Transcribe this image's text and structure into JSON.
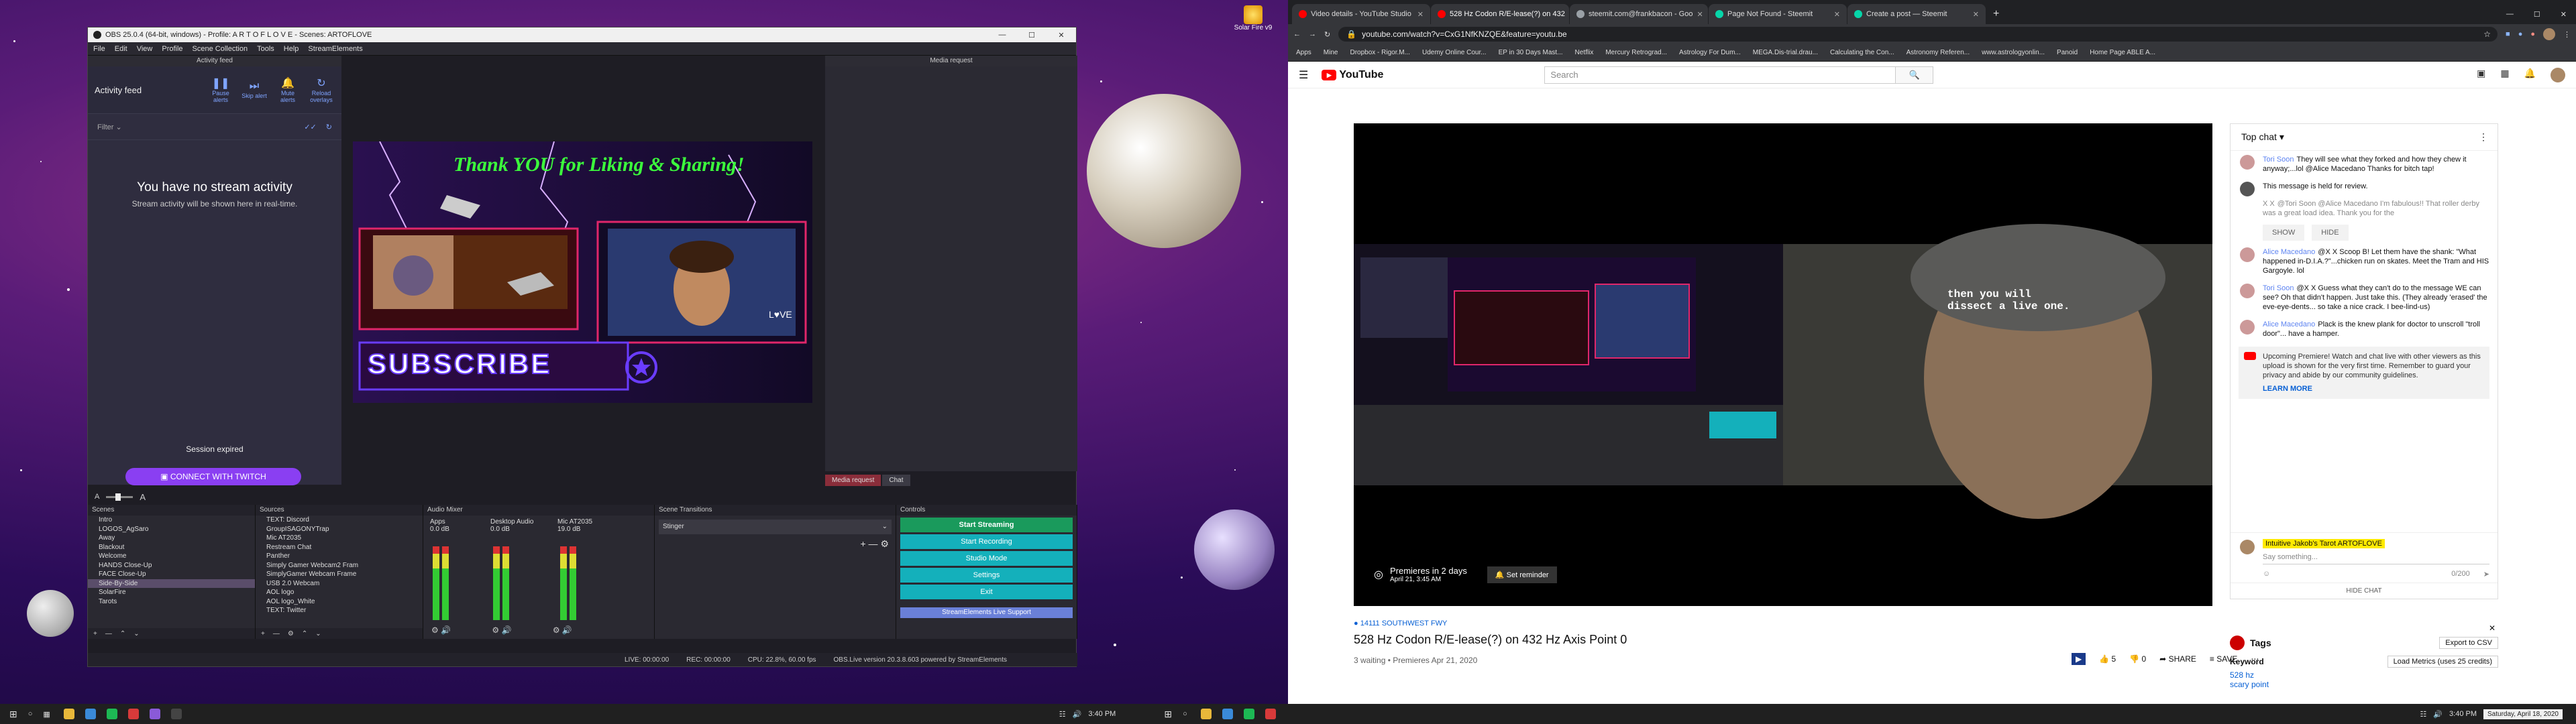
{
  "desktop": {
    "icon_label": "Solar Fire v9"
  },
  "obs": {
    "title": "OBS 25.0.4 (64-bit, windows) - Profile: A R T O F L O V E - Scenes: ARTOFLOVE",
    "menu": [
      "File",
      "Edit",
      "View",
      "Profile",
      "Scene Collection",
      "Tools",
      "Help",
      "StreamElements"
    ],
    "activity": {
      "dock_title": "Activity feed",
      "header": "Activity feed",
      "actions": [
        {
          "icon": "pause-icon",
          "label": "Pause alerts"
        },
        {
          "icon": "skip-icon",
          "label": "Skip alert"
        },
        {
          "icon": "mute-icon",
          "label": "Mute alerts"
        },
        {
          "icon": "reload-icon",
          "label": "Reload overlays"
        }
      ],
      "filter": "Filter",
      "empty_title": "You have no stream activity",
      "empty_text": "Stream activity will be shown here in real-time.",
      "session": "Session expired",
      "connect": "CONNECT WITH TWITCH"
    },
    "preview": {
      "banner": "Thank YOU for Liking & Sharing!",
      "subscribe": "SUBSCRIBE",
      "love": "L♥VE"
    },
    "media": {
      "dock_title": "Media request",
      "tabs": [
        "Media request",
        "Chat"
      ]
    },
    "scenes": {
      "title": "Scenes",
      "items": [
        "Intro",
        "LOGOS_AgSaro",
        "Away",
        "Blackout",
        "Welcome",
        "HANDS Close-Up",
        "FACE Close-Up",
        "Side-By-Side",
        "SolarFire",
        "Tarots"
      ],
      "selected": "Side-By-Side"
    },
    "sources": {
      "title": "Sources",
      "items": [
        "TEXT: Discord",
        "GroupISAGONYTrap",
        "Mic AT2035",
        "Restream Chat",
        "Panther",
        "Simply Gamer Webcam2 Fram",
        "SimplyGamer Webcam Frame",
        "USB 2.0 Webcam",
        "AOL logo",
        "AOL logo_White",
        "TEXT: Twitter"
      ]
    },
    "mixer": {
      "title": "Audio Mixer",
      "channels": [
        {
          "name": "Apps",
          "db": "0.0 dB"
        },
        {
          "name": "Desktop Audio",
          "db": "0.0 dB"
        },
        {
          "name": "Mic AT2035",
          "db": "19.0 dB"
        }
      ]
    },
    "transitions": {
      "title": "Scene Transitions",
      "selected": "Stinger"
    },
    "controls": {
      "title": "Controls",
      "buttons": [
        "Start Streaming",
        "Start Recording",
        "Studio Mode",
        "Settings",
        "Exit"
      ],
      "support": "StreamElements Live Support"
    },
    "status": {
      "live": "LIVE: 00:00:00",
      "rec": "REC: 00:00:00",
      "cpu": "CPU: 22.8%, 60.00 fps",
      "version": "OBS.Live version 20.3.8.603 powered by StreamElements"
    }
  },
  "chrome": {
    "tabs": [
      {
        "title": "Video details - YouTube Studio",
        "color": "#ff0000"
      },
      {
        "title": "528 Hz Codon R/E-lease(?) on 432",
        "color": "#ff0000"
      },
      {
        "title": "steemit.com@frankbacon - Goo",
        "color": "#9aa0a6"
      },
      {
        "title": "Page Not Found - Steemit",
        "color": "#06d6a9"
      },
      {
        "title": "Create a post — Steemit",
        "color": "#06d6a9"
      }
    ],
    "url": "youtube.com/watch?v=CxG1NfKNZQE&feature=youtu.be",
    "bookmarks": [
      "Apps",
      "Mine",
      "Dropbox - Rigor.M...",
      "Udemy Online Cour...",
      "EP in 30 Days Mast...",
      "Netflix",
      "Mercury Retrograd...",
      "Astrology For Dum...",
      "MEGA.Dis-trial.drau...",
      "Calculating the Con...",
      "Astronomy Referen...",
      "www.astrologyonlin...",
      "Panoid",
      "Home Page ABLE A..."
    ],
    "youtube": {
      "logo": "YouTube",
      "search_placeholder": "Search",
      "player": {
        "overlay_text": "then you will\ndissect a live one.",
        "premiere_line1": "Premieres in 2 days",
        "premiere_line2": "April 21, 3:45 AM",
        "reminder": "Set reminder"
      },
      "location": "14111 SOUTHWEST FWY",
      "video_title": "528 Hz Codon R/E-lease(?) on 432 Hz Axis Point 0",
      "meta": "3 waiting • Premieres Apr 21, 2020",
      "actions": {
        "likes": "5",
        "dislikes": "0",
        "share": "SHARE",
        "save": "SAVE"
      },
      "chat": {
        "header": "Top chat",
        "messages": [
          {
            "author": "Tori Soon",
            "text": "They will see what they forked and how they chew it anyway;...lol @Alice Macedano Thanks for bitch tap!"
          },
          {
            "author": "",
            "text": "This message is held for review."
          },
          {
            "author": "X X",
            "text": "@Tori Soon @Alice Macedano I'm fabulous!! That roller derby was a great load idea. Thank you for the"
          },
          {
            "author": "Alice Macedano",
            "text": "@X X Scoop B! Let them have the shank: \"What happened in-D.I.A.?\"...chicken run on skates. Meet the Tram and HIS Gargoyle. lol"
          },
          {
            "author": "Tori Soon",
            "text": "@X X Guess what they can't do to the message WE can see? Oh that didn't happen. Just take this. (They already 'erased' the eve-eye-dents... so take a nice crack. I bee-lind-us)"
          },
          {
            "author": "Alice Macedano",
            "text": "Plack is the knew plank for doctor to unscroll \"troll door\"... have a hamper."
          }
        ],
        "show": "SHOW",
        "hide": "HIDE",
        "premiere_notice": "Upcoming Premiere! Watch and chat live with other viewers as this upload is shown for the very first time. Remember to guard your privacy and abide by our community guidelines.",
        "learn_more": "LEARN MORE",
        "user_label": "Intuitive Jakob's Tarot ARTOFLOVE",
        "input_placeholder": "Say something...",
        "counter": "0/200",
        "hide_chat": "HIDE CHAT"
      },
      "tags": {
        "title": "Tags",
        "export": "Export to CSV",
        "keyword_label": "Keyword",
        "load_metrics": "Load Metrics (uses 25 credits)",
        "keywords": [
          "528 hz",
          "scary point"
        ]
      }
    }
  },
  "taskbar": {
    "time_left": "3:40 PM",
    "time_right": "3:40 PM",
    "date_right": "Saturday, April 18, 2020"
  }
}
